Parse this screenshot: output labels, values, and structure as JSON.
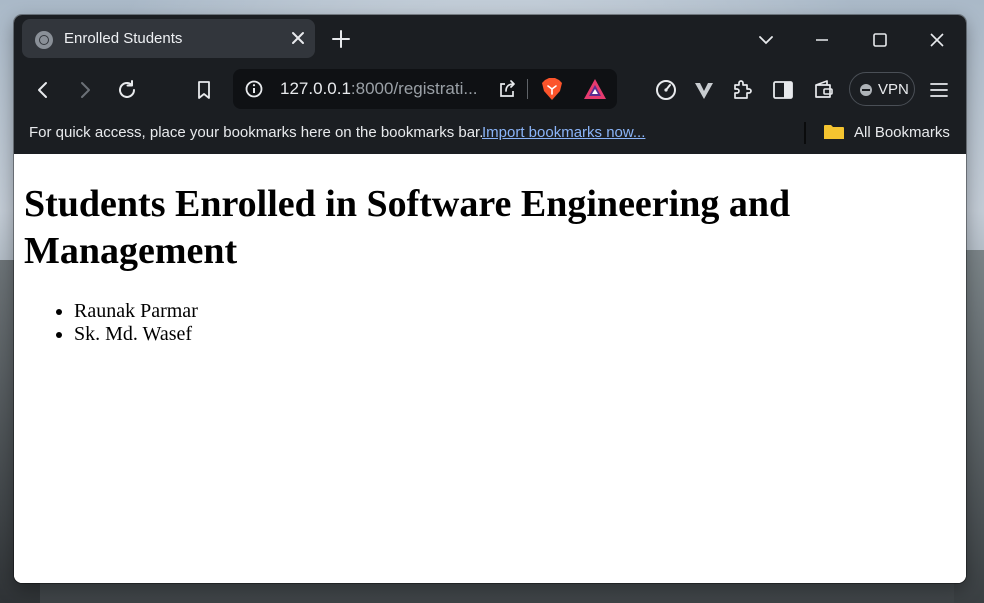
{
  "browser": {
    "tab": {
      "title": "Enrolled Students"
    },
    "url": {
      "host": "127.0.0.1",
      "rest": ":8000/registrati..."
    },
    "vpn_label": "VPN",
    "bookmarks_bar": {
      "hint": "For quick access, place your bookmarks here on the bookmarks bar.",
      "import_link": "Import bookmarks now...",
      "all_bookmarks": "All Bookmarks"
    },
    "icons": {
      "favicon": "globe-icon",
      "close": "close-icon",
      "new_tab": "plus-icon",
      "back": "back-arrow-icon",
      "forward": "forward-arrow-icon",
      "reload": "reload-icon",
      "bookmark": "bookmark-icon",
      "site_info": "info-icon",
      "share": "share-icon",
      "brave_shields": "brave-lion-icon",
      "rewards": "brave-rewards-icon",
      "speedometer": "speedometer-icon",
      "vpn_ext": "v-extension-icon",
      "extensions": "puzzle-icon",
      "sidebar": "sidebar-icon",
      "wallet": "wallet-icon",
      "menu": "hamburger-menu-icon",
      "folder": "folder-icon"
    }
  },
  "page": {
    "heading": "Students Enrolled in Software Engineering and Management",
    "students": [
      "Raunak Parmar",
      "Sk. Md. Wasef"
    ]
  }
}
